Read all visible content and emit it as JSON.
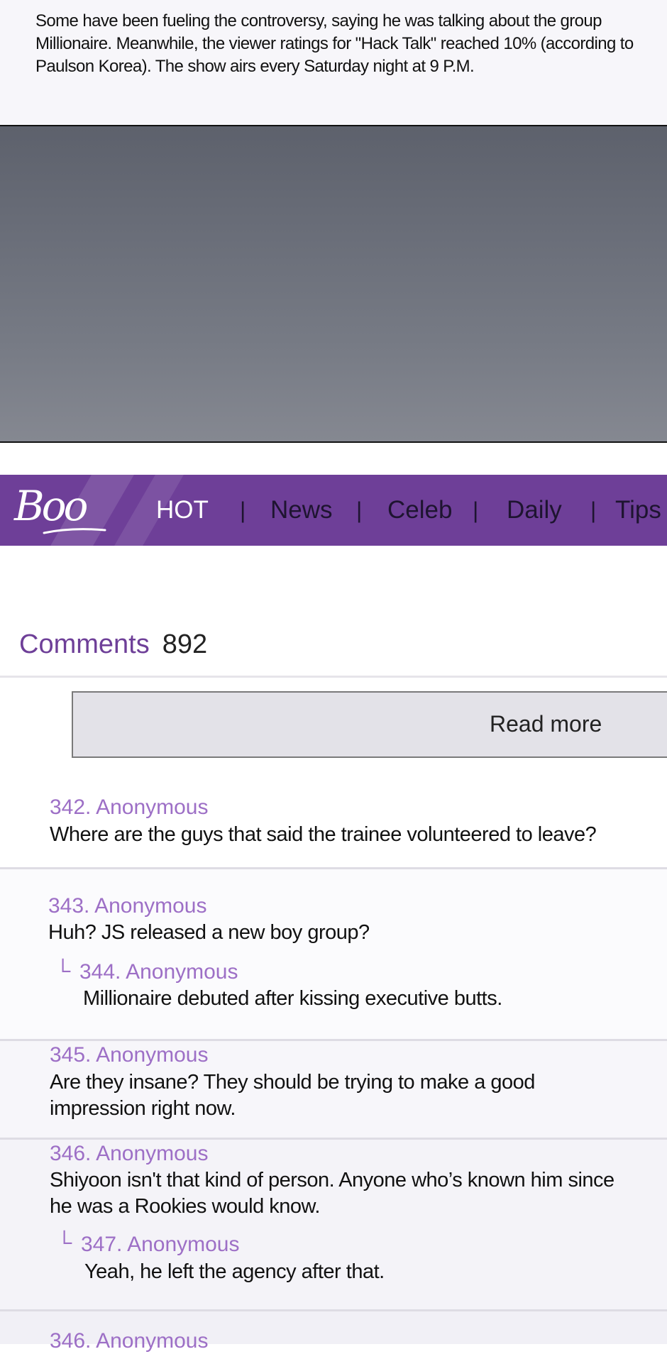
{
  "article": {
    "lines": [
      "Some have been fueling the controversy, saying he was talking about the group",
      "Millionaire. Meanwhile, the viewer ratings for \"Hack Talk\" reached 10% (according to",
      "Paulson Korea). The show airs every Saturday night at 9 P.M."
    ]
  },
  "nav": {
    "logo": "Boo",
    "items": [
      "HOT",
      "News",
      "Celeb",
      "Daily",
      "Tips"
    ],
    "separator": "|",
    "brand_color": "#6e3f98"
  },
  "comments": {
    "label": "Comments",
    "count": "892",
    "read_more": "Read more",
    "list": [
      {
        "author": "342. Anonymous",
        "text": [
          "Where are the guys that said the trainee volunteered to leave?"
        ]
      },
      {
        "author": "343. Anonymous",
        "text": [
          "Huh? JS released a new boy group?"
        ],
        "reply": {
          "mark": "└",
          "author": "344. Anonymous",
          "text": "Millionaire debuted after kissing executive butts."
        }
      },
      {
        "author": "345. Anonymous",
        "text": [
          "Are they insane? They should be trying to make a good",
          "impression right now."
        ]
      },
      {
        "author": "346. Anonymous",
        "text": [
          "Shiyoon isn't that kind of person. Anyone who’s known him since",
          "he was a Rookies would know."
        ],
        "reply": {
          "mark": "└",
          "author": "347. Anonymous",
          "text": "Yeah, he left the agency after that."
        }
      },
      {
        "author": "346. Anonymous",
        "text": []
      }
    ]
  }
}
